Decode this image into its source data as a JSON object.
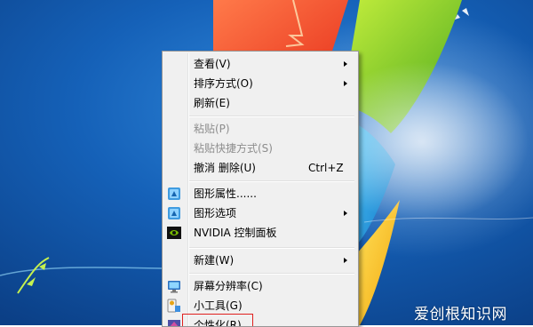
{
  "menu": {
    "items": [
      {
        "label": "查看(V)",
        "submenu": true,
        "enabled": true
      },
      {
        "label": "排序方式(O)",
        "submenu": true,
        "enabled": true
      },
      {
        "label": "刷新(E)",
        "submenu": false,
        "enabled": true
      },
      {
        "label": "粘贴(P)",
        "submenu": false,
        "enabled": false
      },
      {
        "label": "粘贴快捷方式(S)",
        "submenu": false,
        "enabled": false
      },
      {
        "label": "撤消 删除(U)",
        "shortcut": "Ctrl+Z",
        "submenu": false,
        "enabled": true
      },
      {
        "label": "图形属性......",
        "icon": "intel-graphics-icon",
        "submenu": false,
        "enabled": true
      },
      {
        "label": "图形选项",
        "icon": "intel-graphics-icon",
        "submenu": true,
        "enabled": true
      },
      {
        "label": "NVIDIA 控制面板",
        "icon": "nvidia-icon",
        "submenu": false,
        "enabled": true
      },
      {
        "label": "新建(W)",
        "submenu": true,
        "enabled": true
      },
      {
        "label": "屏幕分辨率(C)",
        "icon": "monitor-icon",
        "submenu": false,
        "enabled": true
      },
      {
        "label": "小工具(G)",
        "icon": "gadgets-icon",
        "submenu": false,
        "enabled": true
      },
      {
        "label": "个性化(R)",
        "icon": "personalize-icon",
        "submenu": false,
        "enabled": true
      }
    ]
  },
  "watermark": "爱创根知识网",
  "colors": {
    "desktop_blue": "#1561b8",
    "menu_background": "#f0f0f0",
    "annotation_red": "#e0201e"
  }
}
